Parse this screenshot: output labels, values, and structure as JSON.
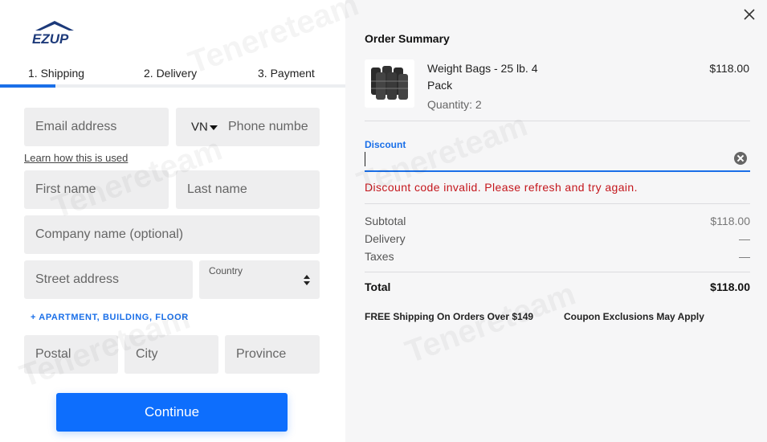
{
  "brand": {
    "logo_text": "EZUP",
    "accent": "#1a6fe8"
  },
  "steps": [
    {
      "label": "1. Shipping",
      "active": true
    },
    {
      "label": "2. Delivery",
      "active": false
    },
    {
      "label": "3. Payment",
      "active": false
    }
  ],
  "form": {
    "email_placeholder": "Email address",
    "phone_country": "VN",
    "phone_placeholder": "Phone numbe",
    "learn_link": "Learn how this is used",
    "first_placeholder": "First name",
    "last_placeholder": "Last name",
    "company_placeholder": "Company name (optional)",
    "street_placeholder": "Street address",
    "country_label": "Country",
    "apartment_link": "+ APARTMENT, BUILDING, FLOOR",
    "postal_placeholder": "Postal",
    "city_placeholder": "City",
    "province_placeholder": "Province",
    "continue_label": "Continue"
  },
  "summary": {
    "title": "Order Summary",
    "item": {
      "name": "Weight Bags - 25 lb. 4 Pack",
      "quantity": "Quantity: 2",
      "price": "$118.00"
    },
    "discount_label": "Discount",
    "discount_error": "Discount code invalid. Please refresh and try again.",
    "subtotal_label": "Subtotal",
    "subtotal_value": "$118.00",
    "delivery_label": "Delivery",
    "delivery_value": "—",
    "taxes_label": "Taxes",
    "taxes_value": "—",
    "total_label": "Total",
    "total_value": "$118.00",
    "note_free_shipping": "FREE Shipping On Orders Over $149",
    "note_coupon": "Coupon Exclusions May Apply"
  },
  "watermark": "Tenereteam"
}
